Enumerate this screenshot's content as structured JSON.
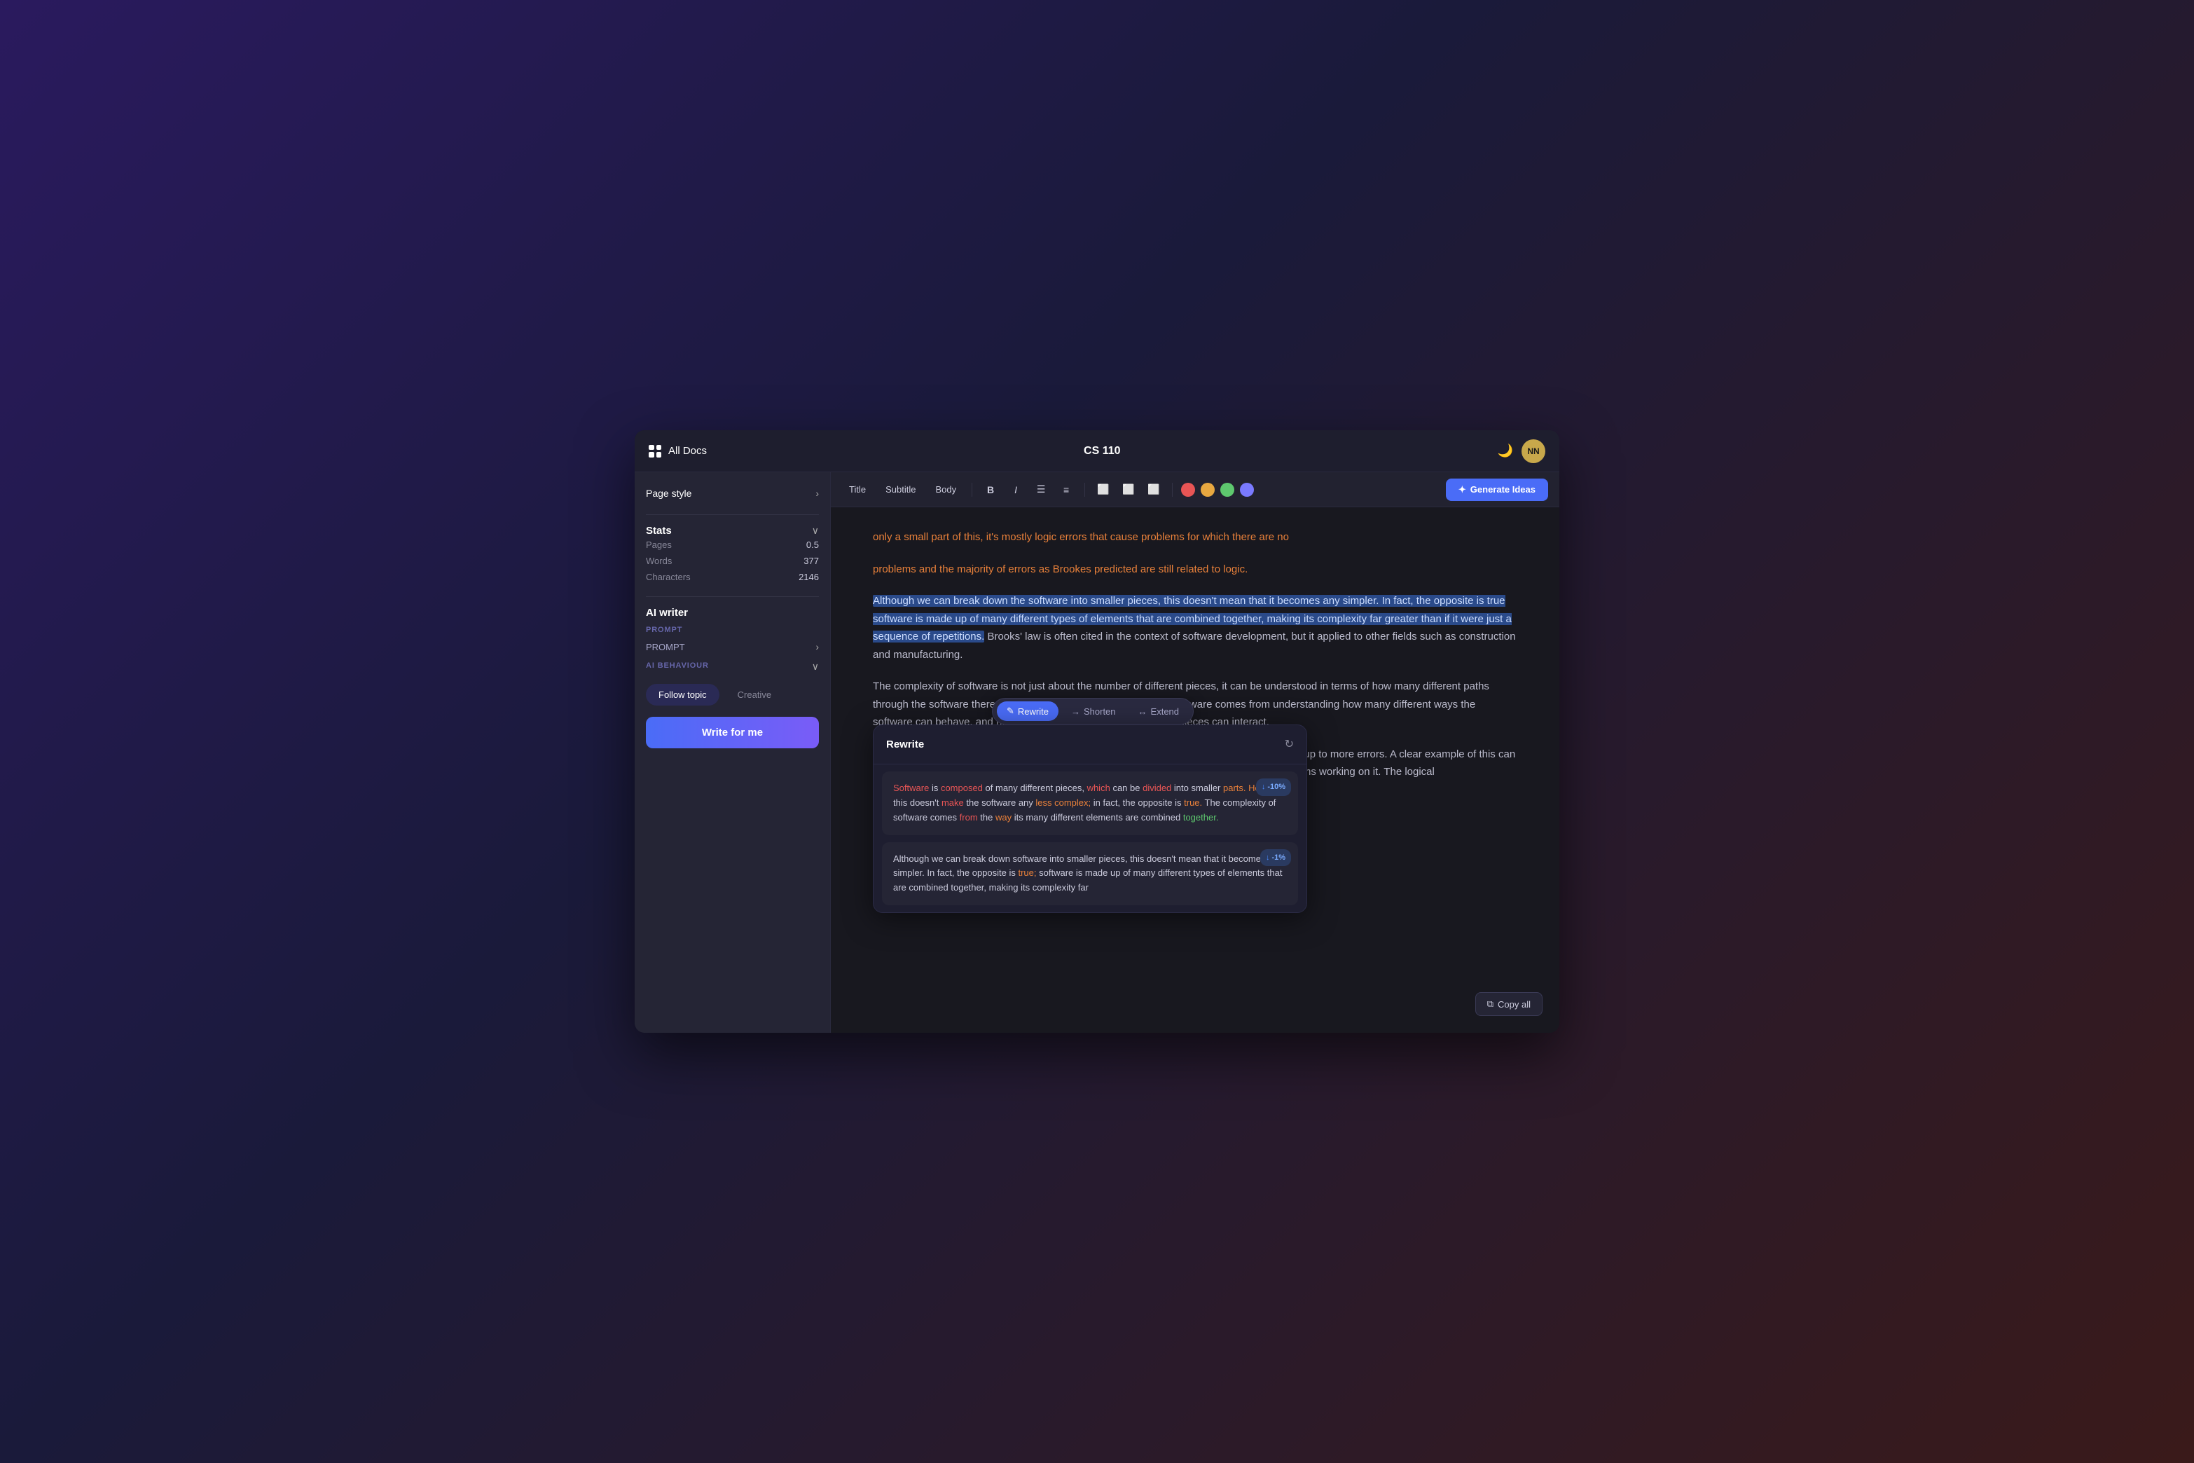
{
  "titleBar": {
    "allDocs": "All Docs",
    "docTitle": "CS 110",
    "avatarInitials": "NN"
  },
  "sidebar": {
    "pageStyle": {
      "label": "Page style",
      "chevron": "›"
    },
    "stats": {
      "title": "Stats",
      "chevron": "∨",
      "rows": [
        {
          "key": "Pages",
          "value": "0.5"
        },
        {
          "key": "Words",
          "value": "377"
        },
        {
          "key": "Characters",
          "value": "2146"
        }
      ]
    },
    "aiWriter": {
      "title": "AI writer",
      "promptLabel": "PROMPT",
      "aiBehaviourLabel": "AI BEHAVIOUR",
      "followTopic": "Follow topic",
      "creative": "Creative",
      "writeForMe": "Write for me"
    }
  },
  "toolbar": {
    "styles": [
      "Title",
      "Subtitle",
      "Body"
    ],
    "generateIdeas": "Generate Ideas",
    "generateIcon": "✦"
  },
  "editor": {
    "orangeLine": "only a small part of this, it's mostly logic errors that cause problems for which there are no",
    "orangeLine2": "problems and the majority of errors as Brookes predicted are still related to logic.",
    "selectedParagraph": "Although we can break down the software into smaller pieces, this doesn't mean that it becomes any simpler. In fact, the opposite is true software is made up of many different types of elements that are combined together, making its complexity far greater than if it were just a sequence of repetitions.",
    "continuationText": " Brooks' law is often cited in the context of software development, but it app­lied to other fields such as construction and manufacturing.",
    "bottomPara1": "The complexity of software is not just about the number of different pieces, it can be understood in terms of how many different paths through the software there are. Understanding the complexity of software comes from understanding how many different ways the software can behave, and how many different ways the individual pieces can interact.",
    "bottomPara2": "On top of that managing, a team with this non-linear increase is even harder, which can lead up to more errors. A clear example of this can be seen in 2020 still with the game cyberpunk with billions of dollars in backing and huge teams working on it. The logical"
  },
  "inlineActions": {
    "rewrite": "Rewrite",
    "shorten": "Shorten",
    "extend": "Extend",
    "rewriteIcon": "✎",
    "shortenIcon": "→",
    "extendIcon": "↔"
  },
  "rewritePopup": {
    "title": "Rewrite",
    "option1": {
      "text1": "Software",
      "connector1": " is ",
      "text2": "composed",
      "connector2": " of many different pieces, ",
      "text3": "which",
      "connector3": " can be ",
      "text4": "divided",
      "connector4": " into smaller ",
      "text5": "parts.",
      "connector5": " ",
      "text6": "However,",
      "connector6": " this doesn't ",
      "text7": "make",
      "connector7": " the software any ",
      "text8": "less complex;",
      "connector8": " in fact, the opposite is ",
      "text9": "true.",
      "connector9": " The complexity of software comes ",
      "text10": "from",
      "connector10": " the ",
      "text11": "way",
      "connector11": " its many different elements are combined ",
      "text12": "together.",
      "badge": "-10%"
    },
    "option2": {
      "text": "Although we can break down software into smaller pieces, this doesn't mean that it becomes any simpler. In fact, the opposite is ",
      "highlight": "true;",
      "text2": " software is made up of many different types of elements that are combined together, making its complexity far",
      "badge": "-1%"
    }
  },
  "copyAll": {
    "label": "Copy all",
    "icon": "⧉"
  },
  "colors": {
    "accent": "#4a6cf7",
    "orange": "#e8803a",
    "red": "#e85555",
    "green": "#5ec86e",
    "selectedBg": "#2a4a8a"
  }
}
